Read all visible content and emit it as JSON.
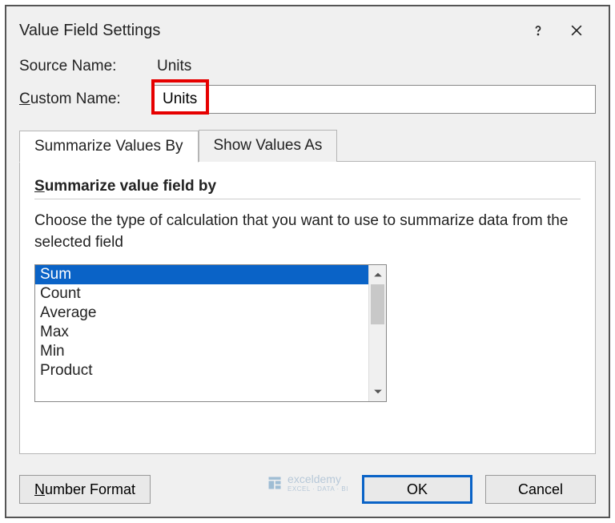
{
  "title": "Value Field Settings",
  "source": {
    "label": "Source Name:",
    "value": "Units"
  },
  "custom": {
    "label": "Custom Name:",
    "value": "Units",
    "underlineChar": "C"
  },
  "tabs": [
    {
      "label": "Summarize Values By",
      "active": true
    },
    {
      "label": "Show Values As",
      "active": false
    }
  ],
  "panel": {
    "heading_underline": "S",
    "heading_rest": "ummarize value field by",
    "description": "Choose the type of calculation that you want to use to summarize data from the selected field",
    "items": [
      "Sum",
      "Count",
      "Average",
      "Max",
      "Min",
      "Product"
    ],
    "selected_index": 0
  },
  "footer": {
    "number_format_underline": "N",
    "number_format_rest": "umber Format",
    "ok": "OK",
    "cancel": "Cancel"
  },
  "watermark": {
    "name": "exceldemy",
    "sub": "EXCEL · DATA · BI"
  }
}
